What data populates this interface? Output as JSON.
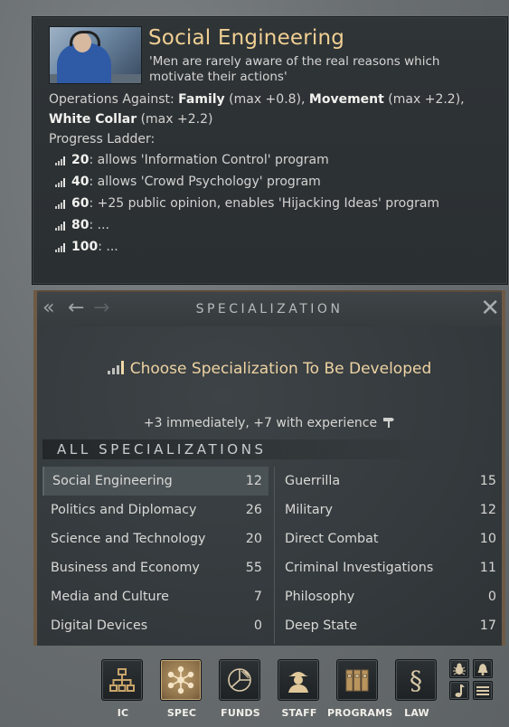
{
  "tooltip": {
    "title": "Social Engineering",
    "quote": "'Men are rarely aware of the real reasons which motivate their actions'",
    "ops_label": "Operations Against: ",
    "ops": [
      {
        "name": "Family",
        "bonus": " (max +0.8), "
      },
      {
        "name": "Movement",
        "bonus": " (max +2.2), "
      },
      {
        "name": "White Collar",
        "bonus": " (max +2.2)"
      }
    ],
    "ladder_label": "Progress Ladder:",
    "ladder": [
      {
        "level": "20",
        "text": ": allows 'Information Control' program"
      },
      {
        "level": "40",
        "text": ": allows 'Crowd Psychology' program"
      },
      {
        "level": "60",
        "text": ": +25 public opinion, enables 'Hijacking Ideas' program"
      },
      {
        "level": "80",
        "text": ": ..."
      },
      {
        "level": "100",
        "text": ": ..."
      }
    ]
  },
  "panel": {
    "title": "SPECIALIZATION",
    "nav": {
      "first": "«",
      "prev": "←",
      "next": "→",
      "close": "✕"
    },
    "choose_text": "Choose Specialization To Be Developed",
    "bonus_text": "+3 immediately, +7 with experience",
    "list_header": "ALL SPECIALIZATIONS",
    "left_column": [
      {
        "name": "Social Engineering",
        "value": "12",
        "selected": true
      },
      {
        "name": "Politics and Diplomacy",
        "value": "26"
      },
      {
        "name": "Science and Technology",
        "value": "20"
      },
      {
        "name": "Business and Economy",
        "value": "55"
      },
      {
        "name": "Media and Culture",
        "value": "7"
      },
      {
        "name": "Digital Devices",
        "value": "0"
      }
    ],
    "right_column": [
      {
        "name": "Guerrilla",
        "value": "15"
      },
      {
        "name": "Military",
        "value": "12"
      },
      {
        "name": "Direct Combat",
        "value": "10"
      },
      {
        "name": "Criminal Investigations",
        "value": "11"
      },
      {
        "name": "Philosophy",
        "value": "0"
      },
      {
        "name": "Deep State",
        "value": "17"
      }
    ]
  },
  "toolbar": {
    "buttons": [
      {
        "label": "IC",
        "icon": "org-chart-icon"
      },
      {
        "label": "SPEC",
        "icon": "network-icon",
        "active": true
      },
      {
        "label": "FUNDS",
        "icon": "pie-chart-icon"
      },
      {
        "label": "STAFF",
        "icon": "agent-icon"
      },
      {
        "label": "PROGRAMS",
        "icon": "binders-icon"
      },
      {
        "label": "LAW",
        "icon": "section-sign-icon",
        "glyph": "§"
      }
    ],
    "mini_buttons": [
      "bug-icon",
      "bell-icon",
      "music-icon",
      "menu-icon"
    ]
  },
  "colors": {
    "title_gold": "#f0cf93",
    "accent_gold": "#eed3a3",
    "frame_brown": "#6e5a44"
  }
}
